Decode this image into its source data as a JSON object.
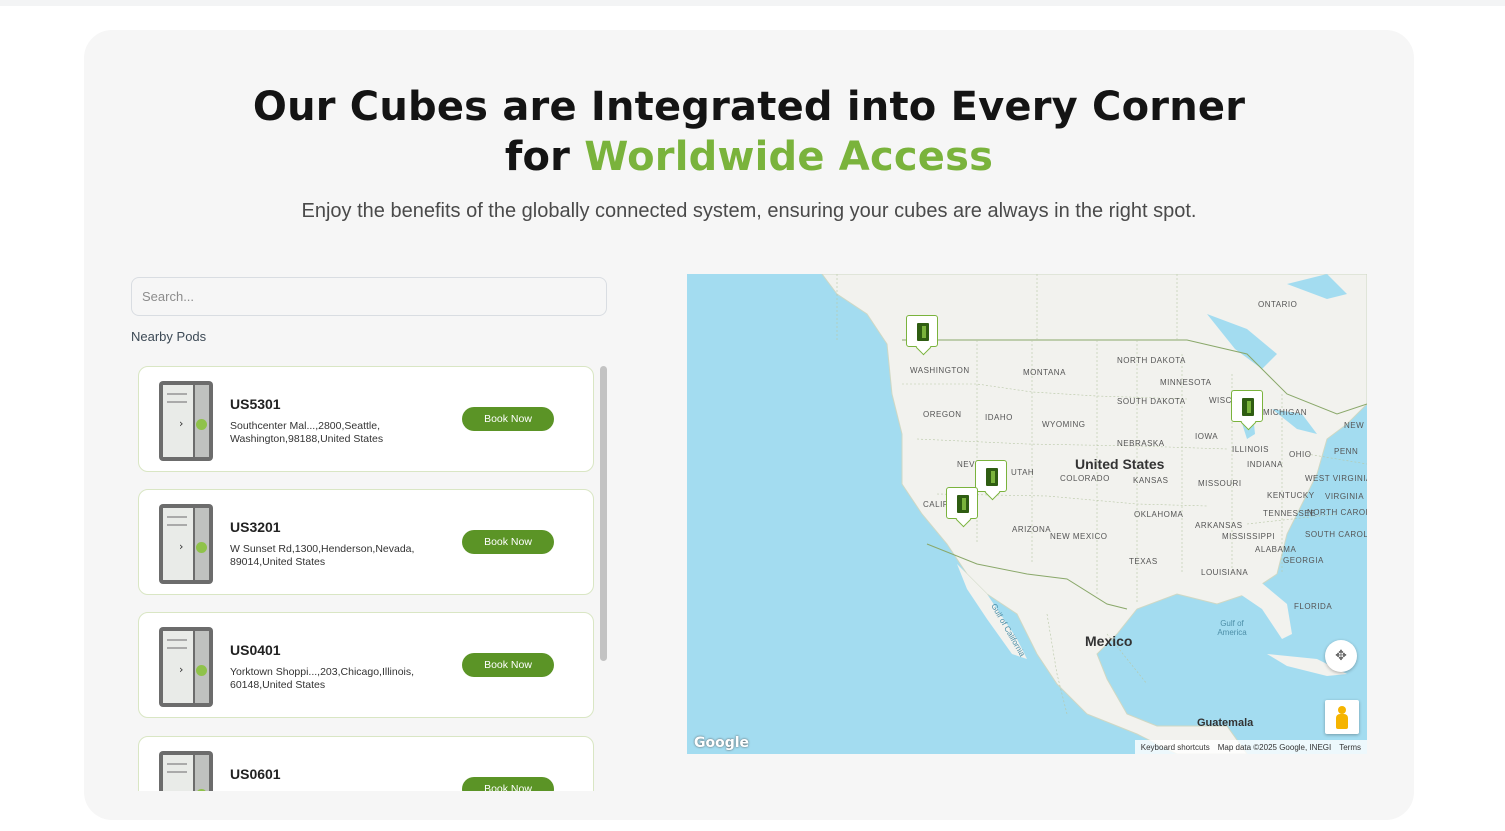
{
  "hero": {
    "title_line1": "Our Cubes are Integrated into Every Corner",
    "title_line2_prefix": "for ",
    "title_line2_accent": "Worldwide Access",
    "subtitle": "Enjoy the benefits of the globally connected system, ensuring your cubes are always in the right spot."
  },
  "search": {
    "placeholder": "Search..."
  },
  "nearby_label": "Nearby Pods",
  "pods": [
    {
      "code": "US5301",
      "address": "Southcenter Mal...,2800,Seattle, Washington,98188,United States",
      "button": "Book Now"
    },
    {
      "code": "US3201",
      "address": "W Sunset Rd,1300,Henderson,Nevada, 89014,United States",
      "button": "Book Now"
    },
    {
      "code": "US0401",
      "address": "Yorktown Shoppi...,203,Chicago,Illinois, 60148,United States",
      "button": "Book Now"
    },
    {
      "code": "US0601",
      "address": "",
      "button": "Book Now"
    }
  ],
  "map": {
    "country_labels": [
      "United States",
      "Mexico",
      "Guatemala"
    ],
    "state_labels": [
      "WASHINGTON",
      "OREGON",
      "IDAHO",
      "MONTANA",
      "WYOMING",
      "NORTH DAKOTA",
      "SOUTH DAKOTA",
      "NEBRASKA",
      "KANSAS",
      "COLORADO",
      "UTAH",
      "NEV",
      "CALIF",
      "ARIZONA",
      "NEW MEXICO",
      "OKLAHOMA",
      "TEXAS",
      "MINNESOTA",
      "IOWA",
      "MISSOURI",
      "ARKANSAS",
      "LOUISIANA",
      "ILLINOIS",
      "INDIANA",
      "OHIO",
      "KENTUCKY",
      "TENNESSEE",
      "MISSISSIPPI",
      "ALABAMA",
      "GEORGIA",
      "SOUTH CAROLINA",
      "NORTH CAROLINA",
      "VIRGINIA",
      "WEST VIRGINIA",
      "PENN",
      "NEW",
      "FLORIDA",
      "ONTARIO",
      "WISC",
      "MICHIGAN"
    ],
    "water_labels": [
      "Gulf of America",
      "Gulf of California"
    ],
    "logo": "Google",
    "attribution": [
      "Keyboard shortcuts",
      "Map data ©2025 Google, INEGI",
      "Terms"
    ],
    "colors": {
      "water": "#a3dcf0",
      "land": "#f2f2ee",
      "pin_border": "#7ab33c",
      "accent": "#7ab33c",
      "button": "#5b9426"
    }
  }
}
